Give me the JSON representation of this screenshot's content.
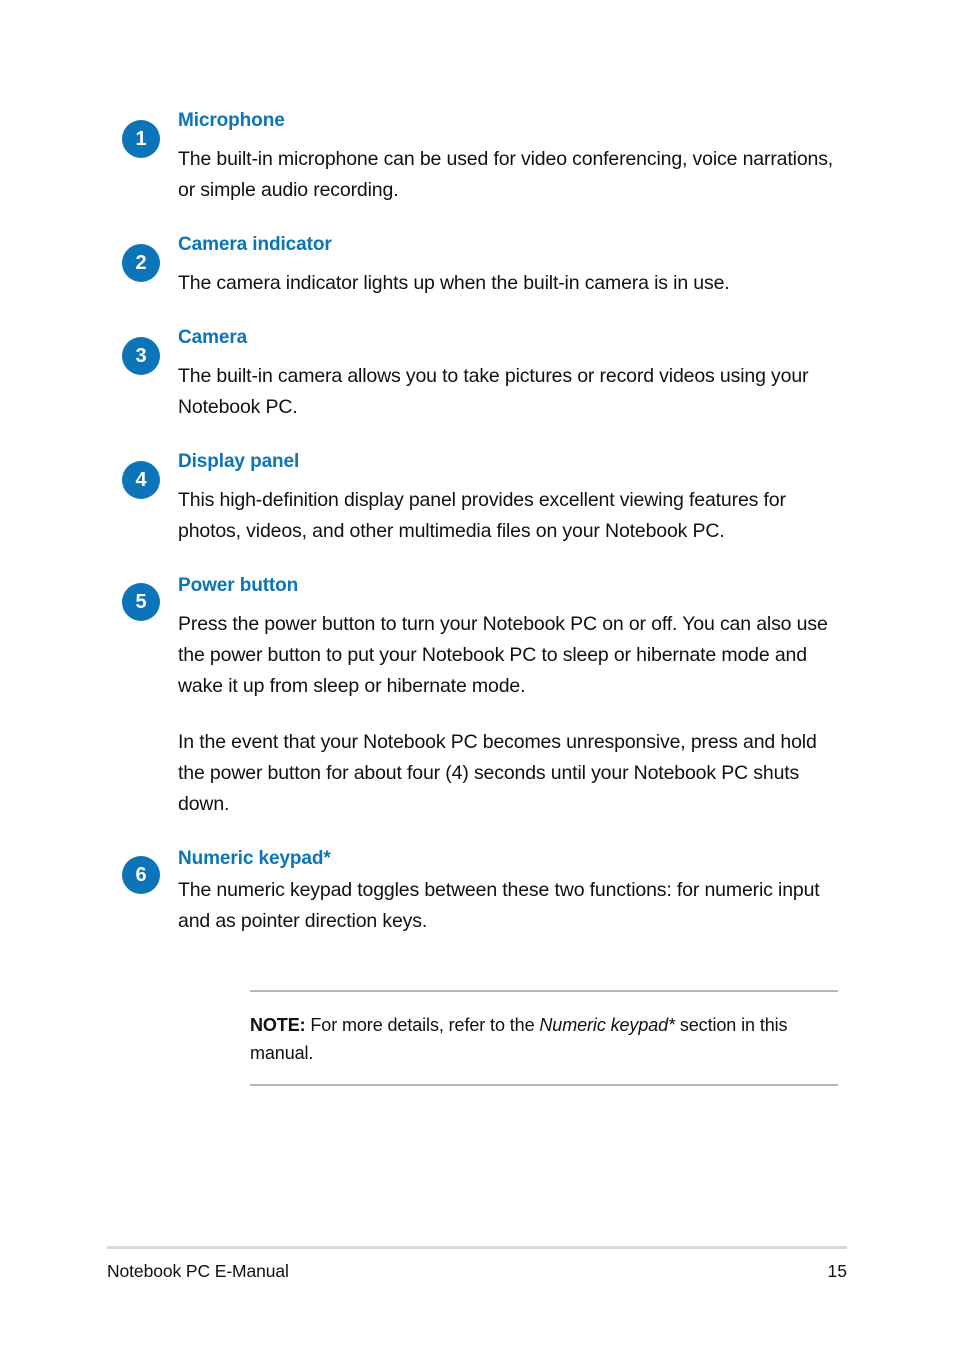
{
  "colors": {
    "accent": "#0c74b8",
    "text": "#111111",
    "rule": "#b8b8b8",
    "footer_rule": "#d9d9d9"
  },
  "items": [
    {
      "number": "1",
      "heading": "Microphone",
      "paragraphs": [
        "The built-in microphone can be used for video conferencing, voice narrations, or simple audio recording."
      ]
    },
    {
      "number": "2",
      "heading": "Camera indicator",
      "paragraphs": [
        "The camera indicator lights up when the built-in camera is in use."
      ]
    },
    {
      "number": "3",
      "heading": "Camera",
      "paragraphs": [
        "The built-in camera allows you to take pictures or record videos using your Notebook PC."
      ]
    },
    {
      "number": "4",
      "heading": "Display panel",
      "paragraphs": [
        "This high-definition display panel provides excellent viewing features for photos, videos, and other multimedia files on your Notebook PC."
      ]
    },
    {
      "number": "5",
      "heading": "Power button",
      "paragraphs": [
        "Press the power button to turn your Notebook PC on or off. You can also use the power button to put your Notebook PC to sleep or hibernate mode and wake it up from sleep or hibernate mode.",
        "In the event that your Notebook PC becomes unresponsive, press and hold the power button for about four (4) seconds until your Notebook PC shuts down."
      ]
    },
    {
      "number": "6",
      "heading": "Numeric keypad*",
      "paragraphs": [
        "The numeric keypad toggles between these two functions: for numeric input and as pointer direction keys."
      ]
    }
  ],
  "note": {
    "label": "NOTE:",
    "text_before": " For more details, refer to the ",
    "emphasis": "Numeric keypad*",
    "text_after": " section in this manual."
  },
  "footer": {
    "left": "Notebook PC E-Manual",
    "page_number": "15"
  }
}
